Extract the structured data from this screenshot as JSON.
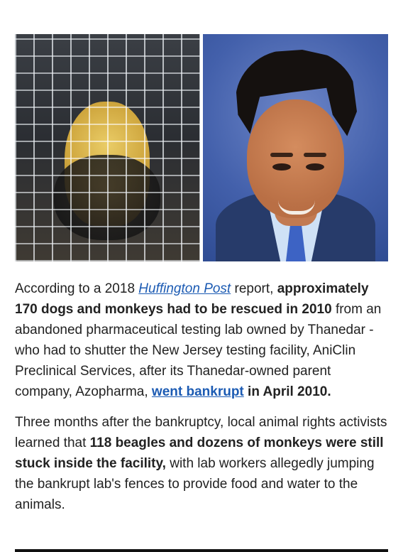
{
  "images": {
    "left_icon": "dog-photo-icon",
    "right_icon": "person-photo-icon"
  },
  "article": {
    "paragraph_1": {
      "t1": "According to a 2018 ",
      "source": "Huffington Post",
      "t2": " report,",
      "t3": "approximately 170 dogs and monkeys had to be rescued in 2010",
      "t4": " from an abandoned pharmaceutical testing lab owned by Thanedar - who had to shutter the New Jersey testing facility, AniClin Preclinical Services, after its Thanedar-owned parent company, Azopharma, ",
      "link": "went bankrupt",
      "t5": " in April 2010."
    },
    "paragraph_2": {
      "t1": "Three months after the bankruptcy, local animal rights activists learned that ",
      "t2": "118 beagles and dozens of monkeys were still stuck inside the facility,",
      "t3": " with lab workers allegedly jumping the bankrupt lab's fences to provide food and water to the animals."
    }
  },
  "colors": {
    "text": "#222222",
    "link": "#1c5bb3",
    "rule": "#111111"
  }
}
